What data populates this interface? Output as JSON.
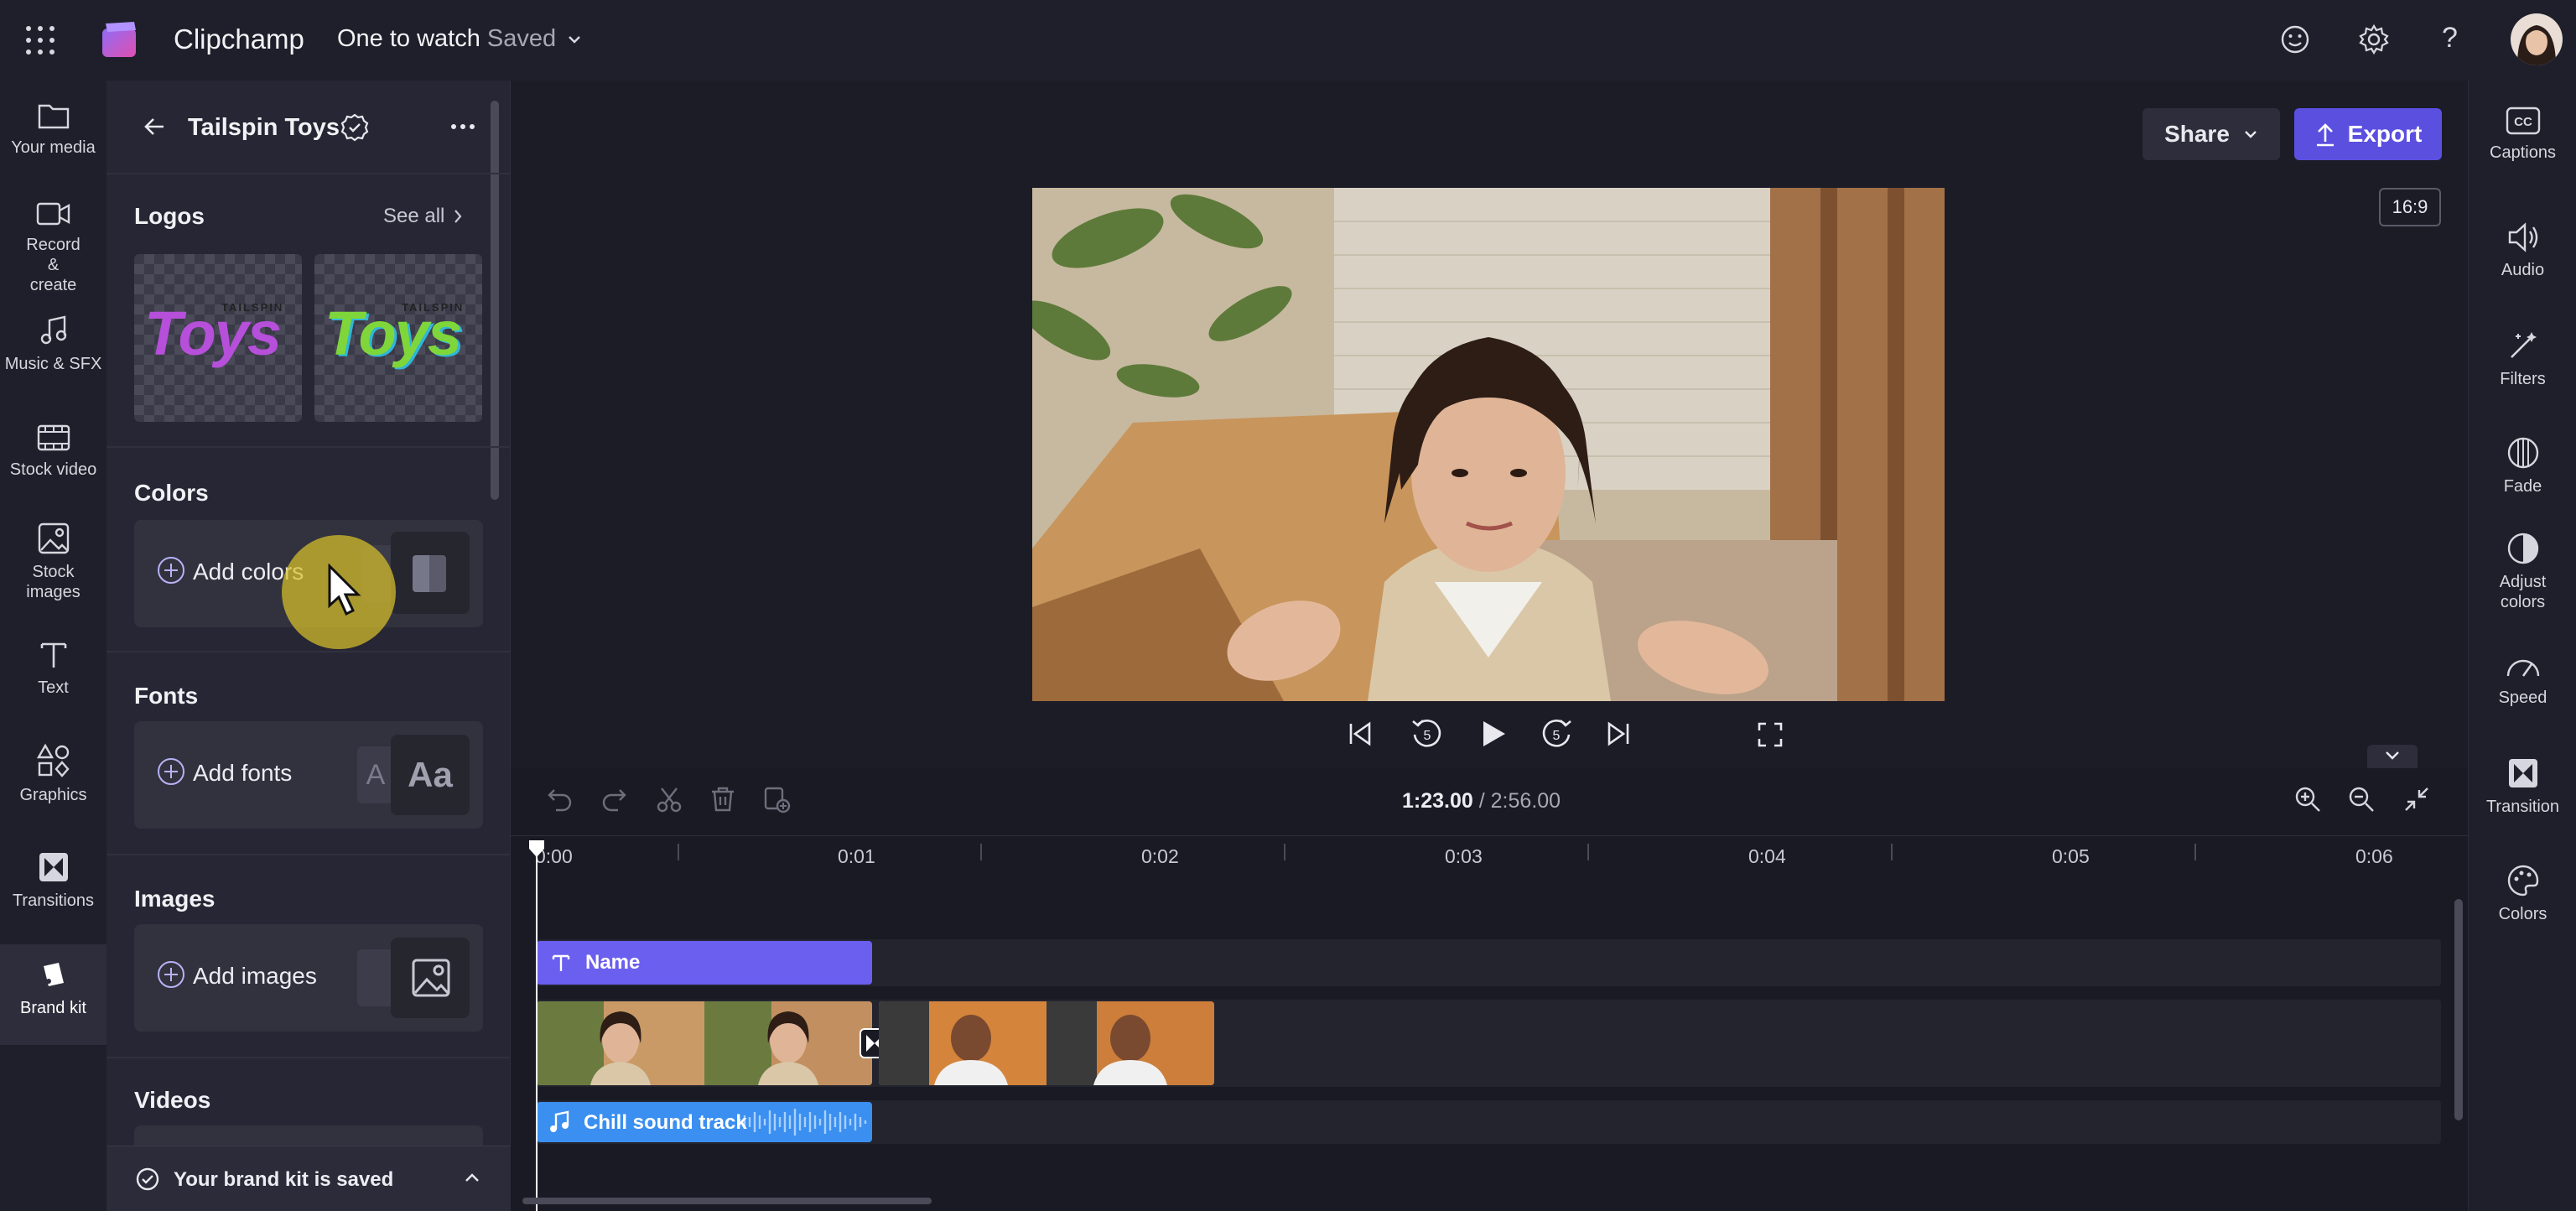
{
  "app": {
    "name": "Clipchamp",
    "project_title": "One to watch",
    "save_status": "Saved"
  },
  "left_nav": [
    {
      "label": "Your media",
      "icon": "folder-icon"
    },
    {
      "label": "Record & create",
      "icon": "video-camera-icon"
    },
    {
      "label": "Music & SFX",
      "icon": "music-note-icon"
    },
    {
      "label": "Stock video",
      "icon": "film-icon"
    },
    {
      "label": "Stock images",
      "icon": "image-icon"
    },
    {
      "label": "Text",
      "icon": "text-icon"
    },
    {
      "label": "Graphics",
      "icon": "shapes-icon"
    },
    {
      "label": "Transitions",
      "icon": "transition-icon"
    },
    {
      "label": "Brand kit",
      "icon": "brand-kit-icon"
    }
  ],
  "brand_panel": {
    "title": "Tailspin Toys",
    "logos": {
      "title": "Logos",
      "see_all": "See all",
      "logo_word_top": "TAILSPIN",
      "logo_word_main": "Toys"
    },
    "colors": {
      "title": "Colors",
      "add_label": "Add colors"
    },
    "fonts": {
      "title": "Fonts",
      "add_label": "Add fonts",
      "sample_small": "A",
      "sample_big": "Aa"
    },
    "images": {
      "title": "Images",
      "add_label": "Add images"
    },
    "videos": {
      "title": "Videos"
    },
    "footer": {
      "status": "Your brand kit is saved"
    }
  },
  "stage": {
    "share_label": "Share",
    "export_label": "Export",
    "aspect_ratio": "16:9"
  },
  "timeline": {
    "current_time": "1:23.00",
    "separator": "/",
    "total_time": "2:56.00",
    "ticks": [
      "0:00",
      "0:01",
      "0:02",
      "0:03",
      "0:04",
      "0:05",
      "0:06"
    ],
    "text_clip": "Name",
    "audio_clip": "Chill sound track"
  },
  "right_bar": [
    {
      "label": "Captions",
      "icon": "captions-icon"
    },
    {
      "label": "Audio",
      "icon": "speaker-icon"
    },
    {
      "label": "Filters",
      "icon": "magic-wand-icon"
    },
    {
      "label": "Fade",
      "icon": "fade-icon"
    },
    {
      "label": "Adjust colors",
      "icon": "contrast-icon"
    },
    {
      "label": "Speed",
      "icon": "speedometer-icon"
    },
    {
      "label": "Transition",
      "icon": "transition-icon"
    },
    {
      "label": "Colors",
      "icon": "palette-icon"
    }
  ],
  "colors": {
    "accent": "#5b4fe0",
    "text_clip": "#6b5ff0",
    "audio_clip": "#3b8ff0",
    "cursor_halo": "#d8c02a"
  }
}
